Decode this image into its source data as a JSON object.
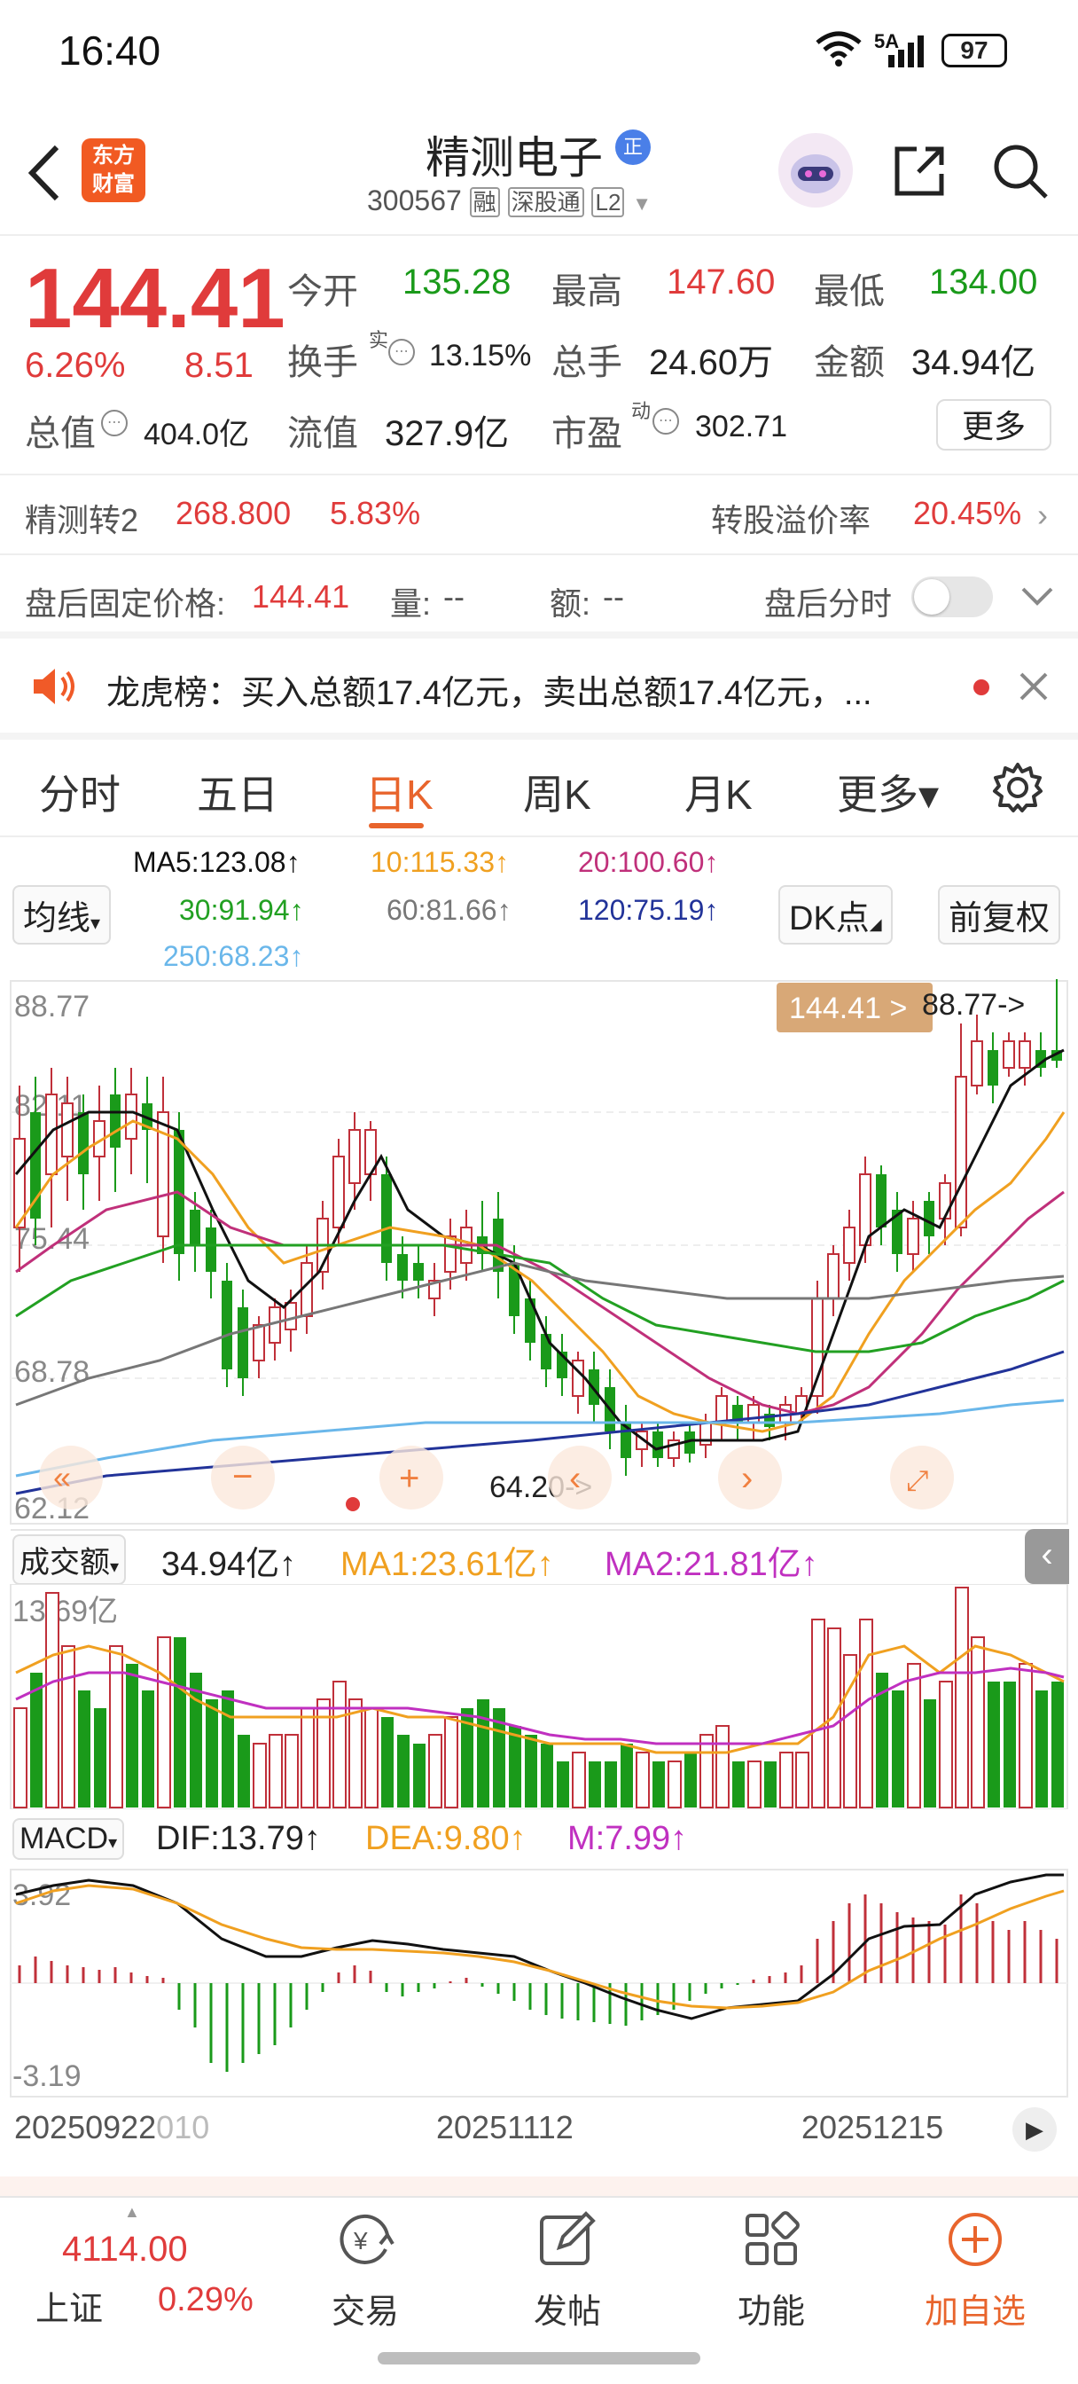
{
  "status_bar": {
    "time": "16:40",
    "network": "5A",
    "battery": "97"
  },
  "header": {
    "logo_line1": "东方",
    "logo_line2": "财富",
    "stock_name": "精测电子",
    "badge": "正",
    "code": "300567",
    "tag1": "融",
    "tag2": "深股通",
    "tag3": "L2"
  },
  "quote": {
    "price": "144.41",
    "change_pct": "6.26%",
    "change": "8.51",
    "open_label": "今开",
    "open": "135.28",
    "high_label": "最高",
    "high": "147.60",
    "low_label": "最低",
    "low": "134.00",
    "turnover_label": "换手",
    "turnover_sup": "实",
    "turnover": "13.15%",
    "volume_label": "总手",
    "volume": "24.60万",
    "amount_label": "金额",
    "amount": "34.94亿",
    "mktcap_label": "总值",
    "mktcap": "404.0亿",
    "float_label": "流值",
    "float": "327.9亿",
    "pe_label": "市盈",
    "pe_sup": "动",
    "pe": "302.71",
    "more_button": "更多"
  },
  "convertible": {
    "name": "精测转2",
    "price": "268.800",
    "pct": "5.83%",
    "premium_label": "转股溢价率",
    "premium": "20.45%"
  },
  "afterhours": {
    "price_label": "盘后固定价格:",
    "price": "144.41",
    "vol_label": "量:",
    "vol": "--",
    "amt_label": "额:",
    "amt": "--",
    "toggle_label": "盘后分时"
  },
  "notice": {
    "text": "龙虎榜：买入总额17.4亿元，卖出总额17.4亿元，..."
  },
  "tabs": [
    "分时",
    "五日",
    "日K",
    "周K",
    "月K",
    "更多▾"
  ],
  "ma_legend": {
    "selector": "均线",
    "ma5": "MA5:123.08↑",
    "ma10": "10:115.33↑",
    "ma20": "20:100.60↑",
    "ma30": "30:91.94↑",
    "ma60": "60:81.66↑",
    "ma120": "120:75.19↑",
    "ma250": "250:68.23↑",
    "dk_button": "DK点",
    "fq_button": "前复权"
  },
  "kline_axis": {
    "y1": "88.77",
    "y2": "82.11",
    "y3": "75.44",
    "y4": "68.78",
    "y5": "62.12"
  },
  "kline_marks": {
    "price_tag": "144.41 >",
    "high_mark": "88.77->",
    "low_mark": "64.20->"
  },
  "volume_legend": {
    "selector": "成交额",
    "value": "34.94亿↑",
    "ma1": "MA1:23.61亿↑",
    "ma2": "MA2:21.81亿↑",
    "max": "13.69亿"
  },
  "macd_legend": {
    "selector": "MACD",
    "dif": "DIF:13.79↑",
    "dea": "DEA:9.80↑",
    "m": "M:7.99↑",
    "max": "3.92",
    "min": "-3.19"
  },
  "dates": {
    "d1": "20250922",
    "d1_tail": "010",
    "d2": "20251112",
    "d3": "20251215"
  },
  "bottom_nav": {
    "index_value": "4114.00",
    "index_name": "上证",
    "index_pct": "0.29%",
    "trade": "交易",
    "post": "发帖",
    "func": "功能",
    "add": "加自选"
  },
  "colors": {
    "up": "#e03b3b",
    "down": "#1a9a1a",
    "accent": "#e8642c",
    "ma5": "#111111",
    "ma10": "#f0a020",
    "ma20": "#c0307a",
    "ma30": "#22a022",
    "ma60": "#777777",
    "ma120": "#223399",
    "ma250": "#6ab7ea"
  }
}
